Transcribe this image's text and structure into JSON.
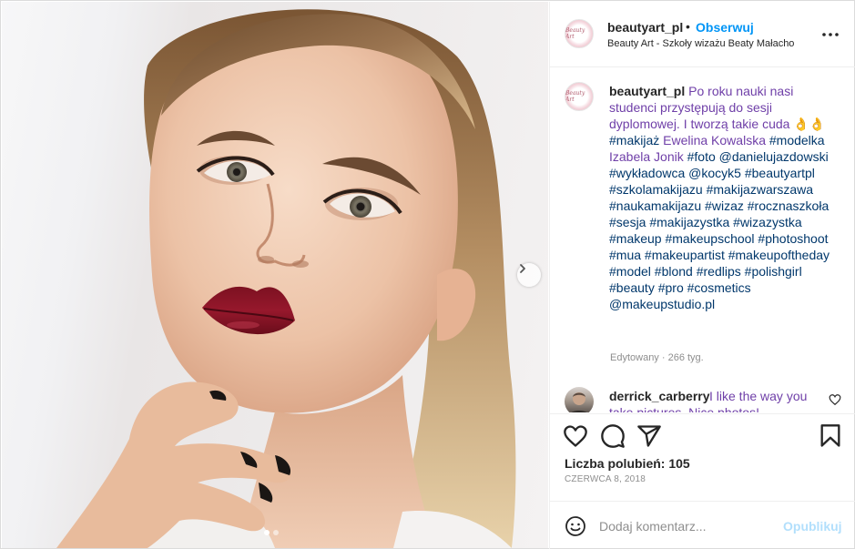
{
  "post": {
    "username": "beautyart_pl",
    "separator": "•",
    "follow_label": "Obserwuj",
    "subtitle": "Beauty Art - Szkoły wizażu Beaty Małacho",
    "avatar_text": "Beauty Art",
    "more_icon": "more-horizontal-icon"
  },
  "caption": {
    "username": "beautyart_pl",
    "intro": "Po roku nauki nasi studenci przystępują do sesji dyplomowej. I tworzą takie cuda",
    "emoji": "👌👌",
    "tag_makijaz": "#makijaż",
    "name_makeup": "Ewelina Kowalska",
    "tag_modelka": "#modelka",
    "name_model": "Izabela Jonik",
    "tag_foto": "#foto",
    "mention_photographer": "@danielujazdowski",
    "tag_wykladowca": "#wykładowca",
    "mention_teacher": "@kocyk5",
    "hashtags": "#beautyartpl #szkolamakijazu #makijazwarszawa #naukamakijazu #wizaz #rocznaszkoła #sesja #makijazystka #wizazystka #makeup #makeupschool #photoshoot #mua #makeupartist #makeupoftheday #model #blond #redlips #polishgirl #beauty #pro #cosmetics",
    "mention_studio": "@makeupstudio.pl",
    "edited": "Edytowany · 266 tyg."
  },
  "comment": {
    "username": "derrick_carberry",
    "text_line1": "I like the way you",
    "text_line2": "take pictures. Nice photos!"
  },
  "actions": {
    "like_icon": "heart-icon",
    "comment_icon": "comment-icon",
    "share_icon": "share-icon",
    "save_icon": "bookmark-icon",
    "likes": "Liczba polubień: 105",
    "date": "CZERWCA 8, 2018"
  },
  "composer": {
    "placeholder": "Dodaj komentarz...",
    "publish_label": "Opublikuj",
    "emoji_icon": "smiley-icon"
  },
  "carousel": {
    "next_icon": "chevron-right-icon",
    "slide_count": 2,
    "active_index": 0
  },
  "colors": {
    "link_blue": "#0095f6",
    "hashtag": "#00376b",
    "translated_purple": "#6f3fa8",
    "muted": "#8e8e8e"
  }
}
